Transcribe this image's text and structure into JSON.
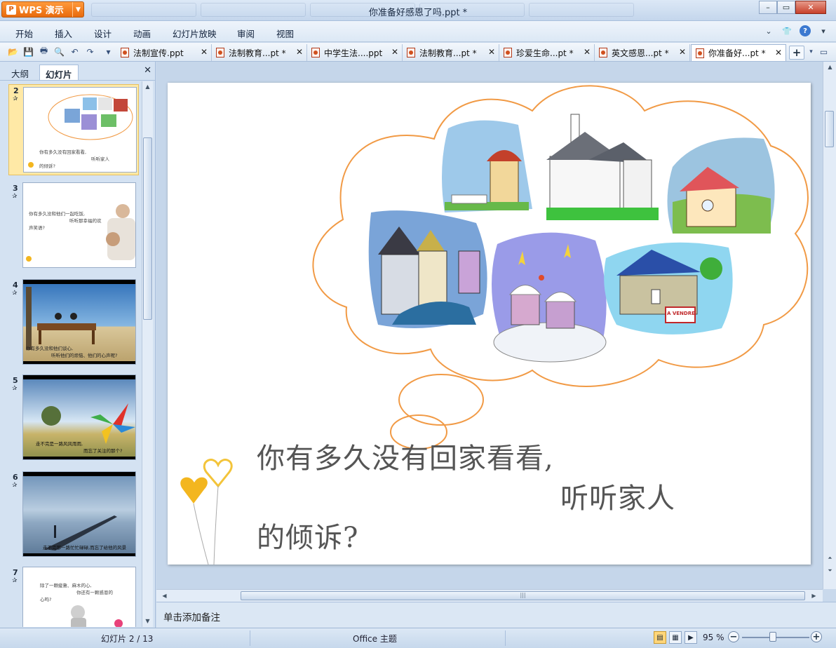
{
  "app": {
    "name": "WPS 演示",
    "window_title": "你准备好感恩了吗.ppt *"
  },
  "menu": [
    "开始",
    "插入",
    "设计",
    "动画",
    "幻灯片放映",
    "审阅",
    "视图"
  ],
  "doc_tabs": [
    {
      "label": "法制宣传.ppt"
    },
    {
      "label": "法制教育...pt *"
    },
    {
      "label": "中学生法....ppt"
    },
    {
      "label": "法制教育...pt *"
    },
    {
      "label": "珍爱生命...pt *"
    },
    {
      "label": "英文感恩...pt *"
    },
    {
      "label": "你准备好...pt *",
      "active": true
    }
  ],
  "left_pane": {
    "tabs": [
      "大纲",
      "幻灯片"
    ],
    "active_tab": "幻灯片",
    "thumbnails": [
      {
        "number": "2",
        "text_lines": [
          "你有多久没有回家看看,",
          "听听家人",
          "的倾诉?"
        ]
      },
      {
        "number": "3",
        "text_lines": [
          "你有多久没和他们一起吃饭,",
          "听听那幸福的欢",
          "声笑语?"
        ]
      },
      {
        "number": "4",
        "text_lines": [
          "你有多久没和他们谈心,",
          "听听他们的烦恼、他们的心声呢?"
        ]
      },
      {
        "number": "5",
        "text_lines": [
          "走不完是一路风风雨雨,",
          "而忘了关注的那个?"
        ]
      },
      {
        "number": "6",
        "text_lines": [
          "走不完那一路忙忙碌碌,而忘了给他的风景"
        ]
      },
      {
        "number": "7",
        "text_lines": [
          "除了一颗疲惫、麻木的心,",
          "你还有一颗感恩的",
          "心吗?"
        ]
      }
    ]
  },
  "slide": {
    "caption_line1": "你有多久没有回家看看,",
    "caption_line2": "听听家人",
    "caption_line3": "的倾诉?",
    "sign_text": "A VENDRE"
  },
  "notes_placeholder": "单击添加备注",
  "status": {
    "slide_pos": "幻灯片 2 / 13",
    "theme": "Office 主题",
    "zoom": "95 %"
  },
  "colors": {
    "accent": "#e8761a",
    "cloud_outline": "#f19a45",
    "selection": "#ffe9a6"
  }
}
